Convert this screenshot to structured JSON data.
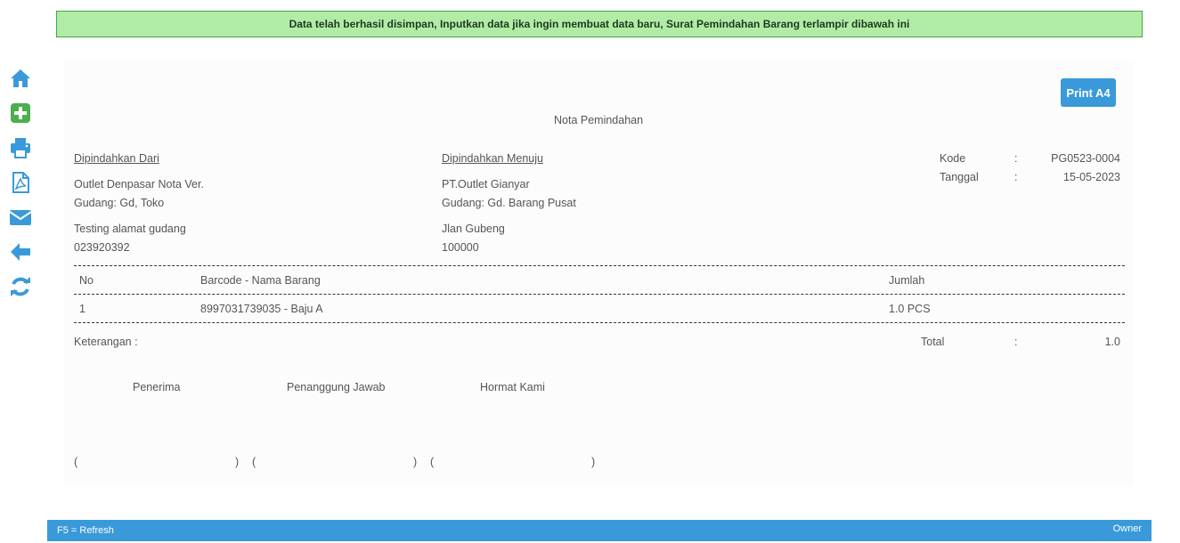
{
  "alert": {
    "message": "Data telah berhasil disimpan, Inputkan data jika ingin membuat data baru, Surat Pemindahan Barang terlampir dibawah ini"
  },
  "sidebar": {
    "icons": [
      "home-icon",
      "add-icon",
      "print-icon",
      "pdf-icon",
      "email-icon",
      "back-icon",
      "refresh-icon"
    ],
    "color_blue": "#3a9ad9",
    "color_green": "#4cae4c"
  },
  "print_button": {
    "label": "Print A4"
  },
  "nota": {
    "title": "Nota Pemindahan",
    "from": {
      "heading": "Dipindahkan Dari",
      "name": "Outlet Denpasar Nota Ver.",
      "gudang": "Gudang: Gd, Toko",
      "alamat": "Testing alamat gudang",
      "phone": "023920392"
    },
    "to": {
      "heading": "Dipindahkan Menuju",
      "name": "PT.Outlet Gianyar",
      "gudang": "Gudang: Gd. Barang Pusat",
      "alamat": "Jlan Gubeng",
      "phone": "100000"
    },
    "meta": {
      "kode_label": "Kode",
      "kode_sep": ":",
      "kode_value": "PG0523-0004",
      "tanggal_label": "Tanggal",
      "tanggal_sep": ":",
      "tanggal_value": "15-05-2023"
    },
    "table": {
      "headers": {
        "no": "No",
        "barang": "Barcode - Nama Barang",
        "jumlah": "Jumlah"
      },
      "rows": [
        {
          "no": "1",
          "barang": "8997031739035 - Baju A",
          "jumlah": "1.0 PCS"
        }
      ]
    },
    "keterangan_label": "Keterangan :",
    "total": {
      "label": "Total",
      "sep": ":",
      "value": "1.0"
    },
    "signatures": {
      "penerima": "Penerima",
      "penanggung": "Penanggung Jawab",
      "hormat": "Hormat Kami",
      "paren_open": "(",
      "paren_close": ")"
    }
  },
  "footer": {
    "left": "F5 = Refresh",
    "right": "Owner"
  }
}
